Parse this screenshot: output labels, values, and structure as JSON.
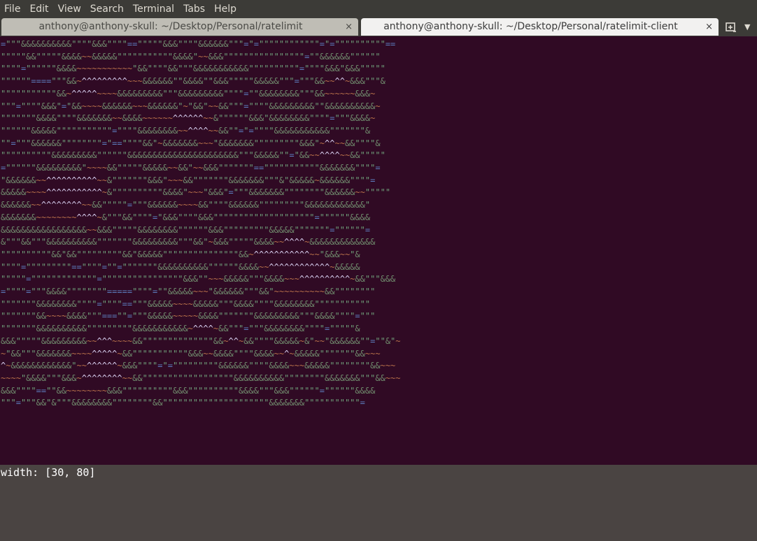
{
  "menubar": {
    "items": [
      "File",
      "Edit",
      "View",
      "Search",
      "Terminal",
      "Tabs",
      "Help"
    ]
  },
  "tabs": [
    {
      "title": "anthony@anthony-skull: ~/Desktop/Personal/ratelimit",
      "close": "×",
      "active": false
    },
    {
      "title": "anthony@anthony-skull: ~/Desktop/Personal/ratelimit-client",
      "close": "×",
      "active": true
    }
  ],
  "tab_controls": {
    "new_tab_icon": "new-tab-icon",
    "menu_icon": "chevron-down-icon",
    "menu_glyph": "▼"
  },
  "terminal": {
    "background": "#300a24",
    "lines": [
      "=\"\"\"&&&&&&&&&&\"\"\"\"&&&\"\"\"\"==\"\"\"\"\"&&&\"\"\"\"&&&&&&\"\"\"=\"=\"\"\"\"\"\"\"\"\"\"\"\"=\"=\"\"\"\"\"\"\"\"\"\"==",
      "\"\"\"\"\"&&\"\"\"\"\"&&&&~~&&&&&\"\"\"\"\"\"\"\"\"\"\"&&&&\"~~&&&\"\"\"\"\"\"\"\"\"\"\"\"\"\"\"\"=\"\"&&&&&&\"\"\"\"\"\"",
      "\"\"\"\"=\"\"\"\"\"\"&&&&~~~~~~~~~~~\"&&\"\"\"\"&&\"\"\"&&&&&&&&&&&\"\"\"\"\"\"\"\"\"\"=\"\"\"\"&&&\"&&&\"\"\"\"\"",
      "\"\"\"\"\"\"====\"\"\"&&~^^^^^^^^^~~~&&&&&&\"\"&&&&\"\"&&&\"\"\"\"\"&&&&&\"\"\"=\"\"\"&&~~^^~&&&\"\"\"&",
      "\"\"\"\"\"\"\"\"\"\"\"&&~^^^^^~~~~&&&&&&&&&\"\"\"&&&&&&&&&\"\"\"\"=\"\"&&&&&&&&\"\"\"&&~~~~~~&&&~",
      "\"\"\"=\"\"\"\"&&&\"=\"&&~~~~&&&&&&~~~&&&&&&\"~\"&&\"~~&&\"\"\"=\"\"\"\"&&&&&&&&&\"\"&&&&&&&&&&~",
      "\"\"\"\"\"\"\"&&&&\"\"\"\"&&&&&&&~~&&&&~~~~~~^^^^^^~~&\"\"\"\"\"\"&&&\"&&&&&&&&\"\"\"\"=\"\"\"&&&&~",
      "\"\"\"\"\"\"&&&&&\"\"\"\"\"\"\"\"\"\"\"=\"\"\"\"&&&&&&&&~~^^^^~~&&\"\"=\"=\"\"\"\"&&&&&&&&&&&\"\"\"\"\"\"\"&",
      "\"\"=\"\"\"&&&&&&\"\"\"\"\"\"\"\"=\"==\"\"\"\"&&\"~&&&&&&&~~~\"&&&&&&&\"\"\"\"\"\"\"\"\"&&&\"~^^~~&&\"\"\"\"&",
      "\"\"\"\"\"\"\"\"\"\"&&&&&&&&&\"\"\"\"\"\"&&&&&&&&&&&&&&&&&&&&&&\"\"\"&&&&&\"\"=\"&&~~^^^^~~&&\"\"\"\"\"",
      "=\"\"\"\"\"\"&&&&&&&&&\"~~~~&&\"\"\"\"\"&&&&&~~&&\"~~&&&\"\"\"\"\"\"\"==\"\"\"\"\"\"\"\"\"\"\"&&&&&&&\"\"\"\"=",
      "\"&&&&&&~~^^^^^^^^^^~~&\"\"\"\"\"\"\"&&&\"~~~&&\"\"\"\"\"\"\"&&&&&&&\"\"\"&\"&&&&&~&&&&&&\"\"\"\"=",
      "&&&&&~~~~^^^^^^^^^^^~&\"\"\"\"\"\"\"\"\"\"&&&&\"~~~\"&&&\"=\"\"\"&&&&&&&\"\"\"\"\"\"\"\"&&&&&&~~\"\"\"\"\"",
      "&&&&&&~~^^^^^^^^~~&&\"\"\"\"\"=\"\"\"&&&&&&~~~~&&\"\"\"\"&&&&&&\"\"\"\"\"\"\"\"\"&&&&&&&&&&&&\"",
      "&&&&&&&~~~~~~~~^^^^~&\"\"\"&&\"\"\"\"=\"&&&\"\"\"\"&&&\"\"\"\"\"\"\"\"\"\"\"\"\"\"\"\"\"\"\"\"=\"\"\"\"\"\"&&&&",
      "&&&&&&&&&&&&&&&&&~~&&&\"\"\"\"\"&&&&&&&&\"\"\"\"\"\"&&&\"\"\"\"\"\"\"\"\"&&&&&\"\"\"\"\"\"\"=\"\"\"\"\"\"=",
      "&\"\"\"&&\"\"\"&&&&&&&&&&\"\"\"\"\"\"\"&&&&&&&&&\"\"\"&&\"~&&&\"\"\"\"\"&&&&~~^^^^~&&&&&&&&&&&&&",
      "\"\"\"\"\"\"\"\"\"\"&&\"&&\"\"\"\"\"\"\"\"\"&&\"&&&&&\"\"\"\"\"\"\"\"\"\"\"\"\"\"\"&&~^^^^^^^^^^^~~\"&&&~~\"&",
      "\"\"\"\"=\"\"\"\"\"\"\"\"\"==\"\"\"\"=\"\"=\"\"\"\"\"\"\"&&&&&&&&&&\"\"\"\"\"\"&&&&~~^^^^^^^^^^^^~&&&&&",
      "\"\"\"\"\"=\"\"\"\"\"\"\"\"\"\"\"\"\"=\"\"\"\"\"\"\"\"\"\"\"\"\"\"\"\"&&&\"\"~~~&&&&&\"\"\"&&&&~~~^^^^^^^^^^~&&\"\"\"&&&",
      "=\"\"\"\"=\"\"\"&&&&\"\"\"\"\"\"\"\"=====\"\"\"\"=\"\"&&&&&~~~\"&&&&&&\"\"\"&&\"~~~~~~~~~~&&\"\"\"\"\"\"\"\"",
      "\"\"\"\"\"\"\"&&&&&&&&\"\"\"\"=\"\"\"\"==\"\"\"&&&&&~~~~&&&&&\"\"\"&&&&\"\"\"\"&&&&&&&&\"\"\"\"\"\"\"\"\"\"\"",
      "\"\"\"\"\"\"\"&&~~~~&&&&\"\"\"===\"\"=\"\"\"&&&&&~~~~~&&&&\"\"\"\"\"\"\"&&&&&&&&&\"\"\"&&&&\"\"\"\"=\"\"\"",
      "\"\"\"\"\"\"\"&&&&&&&&&&\"\"\"\"\"\"\"\"\"&&&&&&&&&&&~^^^^~&&\"\"\"=\"\"\"&&&&&&&&\"\"\"\"=\"\"\"\"\"&",
      "&&&\"\"\"\"\"&&&&&&&&&~~^^^~~~~&&\"\"\"\"\"\"\"\"\"\"\"\"\"\"&&~^^~&&\"\"\"\"&&&&&~&\"~~\"&&&&&&\"\"=\"\"&\"~",
      "~\"&&\"\"\"&&&&&&&~~~~^^^^^~&&\"\"\"\"\"\"\"\"\"\"\"&&&~~&&&&\"\"\"\"&&&&~~^~&&&&&\"\"\"\"\"\"\"&&~~~",
      "^~&&&&&&&&&&&&\"~~^^^^^^~&&&\"\"\"\"=\"=\"\"\"\"\"\"\"\"\"&&&&&&\"\"\"\"&&&&~~~&&&&&\"\"\"\"\"\"\"\"&&~~~",
      "~~~~\"&&&&\"\"\"&&&~^^^^^^^^~~&&\"\"\"\"\"\"\"\"\"\"\"\"\"\"\"\"\"\"&&&&&&&&&&\"\"\"\"\"\"\"\"&&&&&&&\"\"\"&&~~~",
      "&&&\"\"\"\"==\"\"&&~~~~~~~~&&&\"\"\"\"\"\"\"\"\"\"&&&\"\"\"\"\"\"\"\"\"\"&&&&\"\"\"&&&\"\"\"\"\"\"=\"\"\"\"\"\"&&&&",
      "\"\"\"=\"\"\"&&\"&\"\"\"&&&&&&&&\"\"\"\"\"\"\"\"&&\"\"\"\"\"\"\"\"\"\"\"\"\"\"\"\"\"\"\"\"\"&&&&&&&\"\"\"\"\"\"\"\"\"\"\"="
    ]
  },
  "status": {
    "text": "width: [30, 80]"
  }
}
